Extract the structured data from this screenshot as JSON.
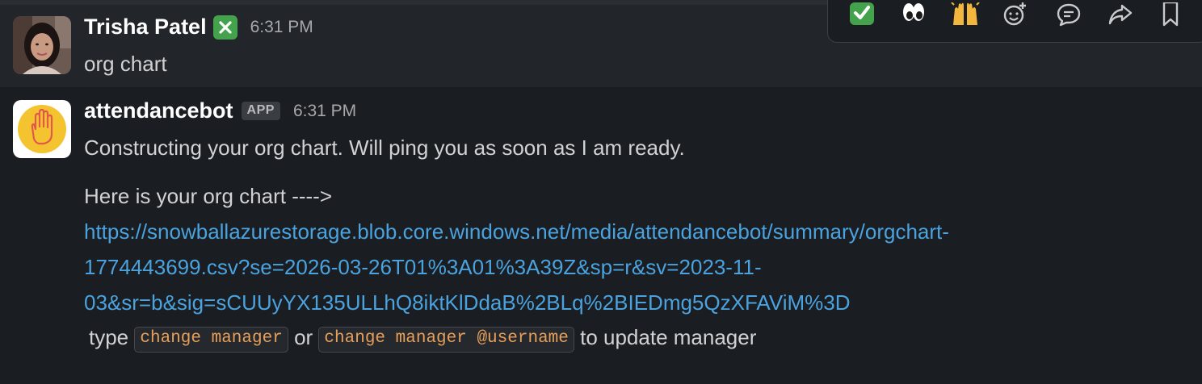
{
  "messages": [
    {
      "sender": "Trisha Patel",
      "status_emoji": "negative-squared-cross-mark",
      "time": "6:31 PM",
      "text": "org chart"
    },
    {
      "sender": "attendancebot",
      "badge": "APP",
      "time": "6:31 PM",
      "text": "Constructing your org chart. Will ping you as soon as I am ready.",
      "intro": "Here is your org chart ---->",
      "link_lines": [
        "https://snowballazurestorage.blob.core.windows.net/media/attendancebot/summary/orgchart-",
        "1774443699.csv?se=2026-03-26T01%3A01%3A39Z&sp=r&sv=2023-11-",
        "03&sr=b&sig=sCUUyYX135ULLhQ8iktKlDdaB%2BLq%2BIEDmg5QzXFAViM%3D"
      ],
      "instruction": {
        "prefix": "type",
        "command_1": "change manager",
        "conjunction": "or",
        "command_2": "change manager @username",
        "suffix": "to update manager"
      }
    }
  ],
  "toolbar": {
    "items": [
      "white-check-mark-emoji",
      "eyes-emoji",
      "raised-hands-emoji",
      "add-reaction-icon",
      "reply-in-thread-icon",
      "share-icon",
      "save-bookmark-icon"
    ]
  },
  "colors": {
    "background": "#1a1d21",
    "hover_row": "#222529",
    "link": "#4aa3df",
    "code_text": "#e8a05b",
    "bot_avatar": "#f4c430"
  }
}
